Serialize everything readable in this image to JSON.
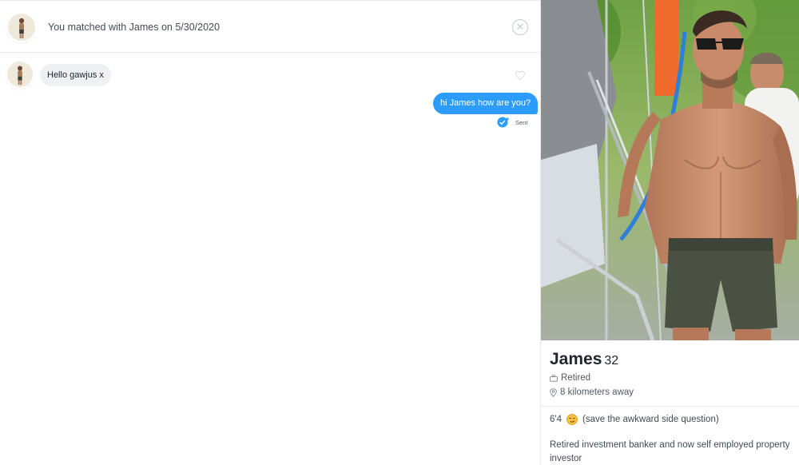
{
  "match_header": {
    "text": "You matched with James on 5/30/2020",
    "close_icon": "close-circle-icon"
  },
  "messages": [
    {
      "direction": "received",
      "text": "Hello gawjus x"
    },
    {
      "direction": "sent",
      "text": "hi James how are you?",
      "status": "Sent"
    }
  ],
  "colors": {
    "sent_bubble": "#2c9cff",
    "received_bubble": "#eef0f3",
    "text_primary": "#21262e",
    "text_secondary": "#505965"
  },
  "profile": {
    "name": "James",
    "age": "32",
    "job": "Retired",
    "job_icon": "briefcase-icon",
    "distance": "8 kilometers away",
    "distance_icon": "location-pin-icon",
    "bio_height": "6'4",
    "bio_emoji": "smirk-emoji-icon",
    "bio_aside": "(save the awkward side question)",
    "bio_text": "Retired investment banker and now self employed property investor"
  }
}
